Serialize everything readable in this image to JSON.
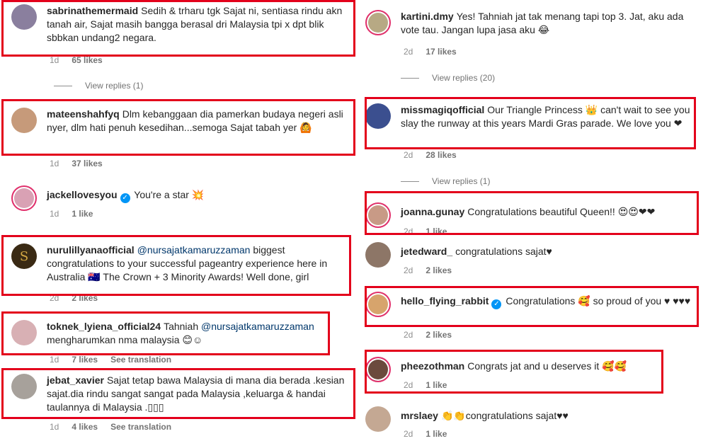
{
  "left": [
    {
      "user": "sabrinathemermaid",
      "text": "Sedih & trharu tgk Sajat ni, sentiasa rindu akn tanah air, Sajat masih bangga berasal dri Malaysia tpi x dpt blik sbbkan undang2 negara.",
      "time": "1d",
      "likes": "65 likes",
      "replies": "View replies (1)"
    },
    {
      "user": "mateenshahfyq",
      "text": "Dlm kebanggaan dia pamerkan budaya negeri asli nyer, dlm hati penuh kesedihan...semoga Sajat tabah yer 🙆",
      "time": "1d",
      "likes": "37 likes"
    },
    {
      "user": "jackellovesyou",
      "text": "You're a star 💥",
      "time": "1d",
      "likes": "1 like"
    },
    {
      "user": "nurulillyanaofficial",
      "mention": "@nursajatkamaruzzaman",
      "text": "biggest congratulations to your successful pageantry experience here in Australia 🇦🇺 The Crown + 3 Minority Awards! Well done, girl",
      "time": "2d",
      "likes": "2 likes"
    },
    {
      "user": "toknek_lyiena_official24",
      "text_pre": "Tahniah",
      "mention": "@nursajatkamaruzzaman",
      "text": "mengharumkan nma malaysia 😊☺",
      "time": "1d",
      "likes": "7 likes",
      "translate": "See translation"
    },
    {
      "user": "jebat_xavier",
      "text": "Sajat tetap bawa Malaysia di mana dia berada .kesian sajat.dia rindu sangat sangat pada Malaysia ,keluarga & handai taulannya di Malaysia .▯▯▯",
      "time": "1d",
      "likes": "4 likes",
      "translate": "See translation"
    }
  ],
  "right": [
    {
      "user": "kartini.dmy",
      "text": "Yes! Tahniah jat tak menang tapi top 3. Jat, aku ada vote tau. Jangan lupa jasa aku 😂",
      "time": "2d",
      "likes": "17 likes",
      "replies": "View replies (20)"
    },
    {
      "user": "missmagiqofficial",
      "text": "Our Triangle Princess 👑 can't wait to see you slay the runway at this years Mardi Gras parade. We love you ❤",
      "time": "2d",
      "likes": "28 likes",
      "replies": "View replies (1)"
    },
    {
      "user": "joanna.gunay",
      "text": "Congratulations beautiful Queen!! 😍😍❤❤",
      "time": "2d",
      "likes": "1 like"
    },
    {
      "user": "jetedward_",
      "text": "congratulations sajat♥",
      "time": "2d",
      "likes": "2 likes"
    },
    {
      "user": "hello_flying_rabbit",
      "text": "Congratulations 🥰 so proud of you ♥ ♥♥♥",
      "time": "2d",
      "likes": "2 likes"
    },
    {
      "user": "pheezothman",
      "text": "Congrats jat and u deserves it 🥰🥰",
      "time": "2d",
      "likes": "1 like"
    },
    {
      "user": "mrslaey",
      "text": "👏👏congratulations sajat♥♥",
      "time": "2d",
      "likes": "1 like"
    }
  ],
  "colors": {
    "highlight": "#e3001b",
    "ring": "#e1306c",
    "verified": "#0095f6",
    "mention": "#00376b"
  }
}
